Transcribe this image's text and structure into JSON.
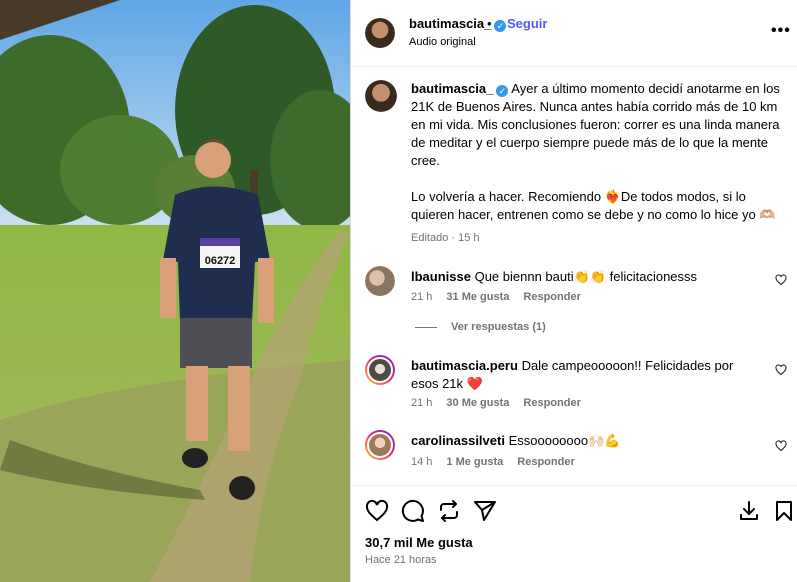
{
  "header": {
    "username": "bautimascia_",
    "follow_label": "Seguir",
    "separator": "•",
    "audio": "Audio original",
    "more": "•••"
  },
  "caption": {
    "username": "bautimascia_",
    "paragraph1": "Ayer a último momento decidí anotarme en los 21K de Buenos Aires. Nunca antes había corrido más de 10 km en mi vida. Mis conclusiones fueron: correr es una linda manera de meditar y el cuerpo siempre puede más de lo que la mente cree.",
    "paragraph2": "Lo volvería a hacer. Recomiendo ❤️‍🔥De todos modos, si lo quieren hacer, entrenen como se debe y no como lo hice yo 🫶🏼",
    "edited": "Editado",
    "time": "15 h"
  },
  "comments": [
    {
      "username": "lbaunisse",
      "text": "Que biennn bauti👏👏 felicitacionesss",
      "time": "21 h",
      "likes": "31 Me gusta",
      "reply": "Responder",
      "avatar_color": "#b89f86"
    },
    {
      "username": "bautimascia.peru",
      "text": "Dale campeooooon!! Felicidades por esos 21k ❤️",
      "time": "21 h",
      "likes": "30 Me gusta",
      "reply": "Responder",
      "avatar_color": "#5e5a55"
    },
    {
      "username": "carolinassilveti",
      "text": "Essoooooooo🙌🏻💪",
      "time": "14 h",
      "likes": "1 Me gusta",
      "reply": "Responder",
      "avatar_color": "#c7a98c"
    }
  ],
  "view_replies": "Ver respuestas (1)",
  "footer": {
    "likes": "30,7 mil Me gusta",
    "posted": "Hace 21 horas"
  },
  "photo": {
    "bib_number": "06272"
  },
  "colors": {
    "follow": "#4a5df9",
    "verified": "#3897f0",
    "meta_gray": "#737373",
    "story_ring_start": "#f9ce34",
    "story_ring_end": "#c13584"
  }
}
